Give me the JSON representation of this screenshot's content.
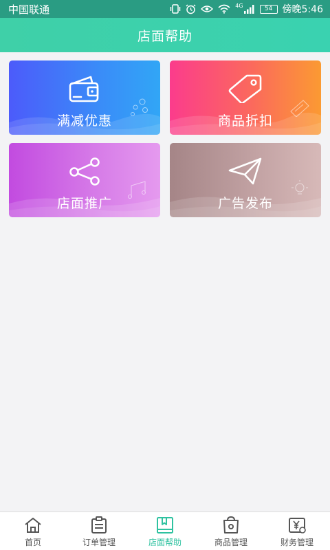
{
  "status_bar": {
    "carrier": "中国联通",
    "network": "4G",
    "battery": "54",
    "time": "傍晚5:46"
  },
  "header": {
    "title": "店面帮助"
  },
  "cards": [
    {
      "label": "满减优惠",
      "icon": "wallet-icon",
      "colors": [
        "#4c5bfa",
        "#31a6f6"
      ]
    },
    {
      "label": "商品折扣",
      "icon": "price-tag-icon",
      "colors": [
        "#fb3c8c",
        "#fb9a32"
      ]
    },
    {
      "label": "店面推广",
      "icon": "share-icon",
      "colors": [
        "#c24be0",
        "#e59aef"
      ]
    },
    {
      "label": "广告发布",
      "icon": "paper-plane-icon",
      "colors": [
        "#a58587",
        "#d7b9b8"
      ]
    }
  ],
  "bottom_nav": {
    "active_index": 2,
    "active_color": "#2fc2a0",
    "items": [
      {
        "label": "首页",
        "icon": "home-icon"
      },
      {
        "label": "订单管理",
        "icon": "order-list-icon"
      },
      {
        "label": "店面帮助",
        "icon": "help-book-icon"
      },
      {
        "label": "商品管理",
        "icon": "shopping-bag-icon"
      },
      {
        "label": "财务管理",
        "icon": "finance-icon"
      }
    ]
  },
  "colors": {
    "header": "#3ad2b0",
    "status_bar": "#2a9c83",
    "background": "#f3f3f5"
  }
}
